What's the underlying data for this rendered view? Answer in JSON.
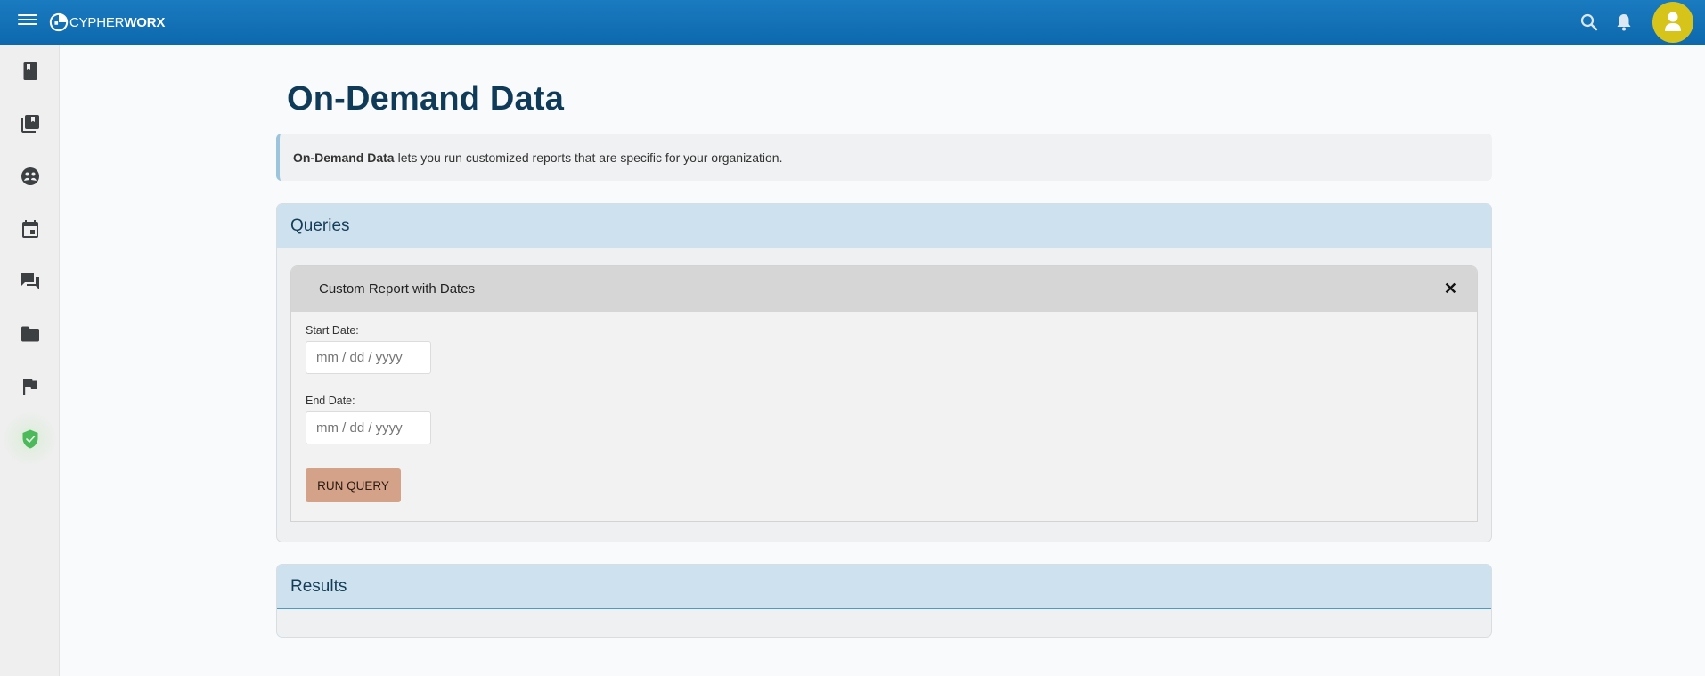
{
  "header": {
    "logo_text_light": "CYPHER",
    "logo_text_bold": "WORX",
    "icons": [
      "menu-icon",
      "search-icon",
      "bell-icon",
      "user-avatar-icon"
    ]
  },
  "sidebar": {
    "items": [
      {
        "name": "book-icon"
      },
      {
        "name": "library-icon"
      },
      {
        "name": "community-icon"
      },
      {
        "name": "calendar-icon"
      },
      {
        "name": "chat-icon"
      },
      {
        "name": "folder-icon"
      },
      {
        "name": "flag-icon"
      },
      {
        "name": "shield-check-icon",
        "active": true
      }
    ]
  },
  "main": {
    "title": "On-Demand Data",
    "info_bold": "On-Demand Data",
    "info_text": "lets you run customized reports that are specific for your organization.",
    "queries": {
      "title": "Queries",
      "card_title": "Custom Report with Dates",
      "close_label": "✕",
      "start_label": "Start Date:",
      "start_placeholder": "mm / dd / yyyy",
      "end_label": "End Date:",
      "end_placeholder": "mm / dd / yyyy",
      "run_label": "RUN QUERY"
    },
    "results": {
      "title": "Results"
    }
  },
  "colors": {
    "topbar": "#1273b8",
    "avatar": "#d7c41a",
    "title": "#0f3b59",
    "panel_header": "#cde2ee",
    "run_button": "#d4a289",
    "shield_active": "#4cba5a"
  }
}
